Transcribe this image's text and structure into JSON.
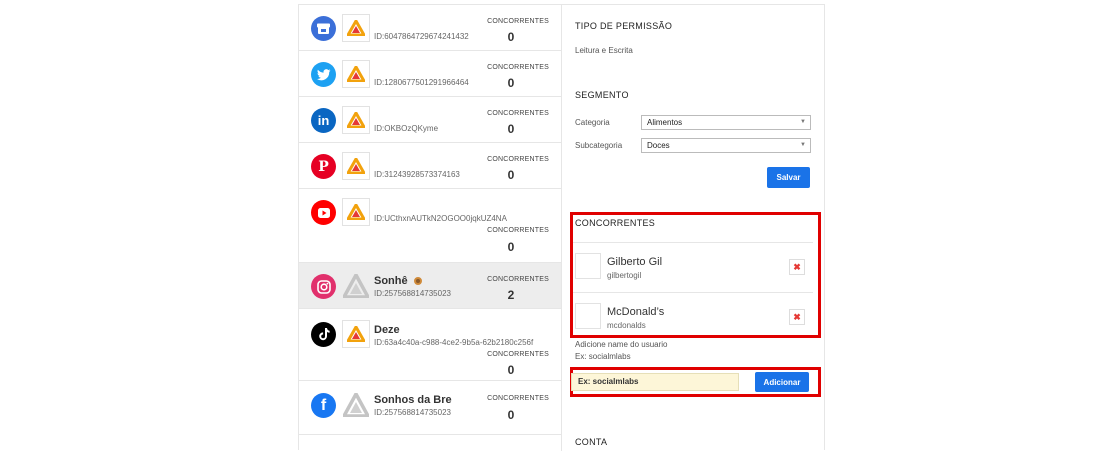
{
  "accounts": [
    {
      "network": "google-business",
      "color": "#3b6fd8",
      "name": "",
      "id": "ID:6047864729674241432",
      "conc_label": "CONCORRENTES",
      "conc_value": "0"
    },
    {
      "network": "twitter",
      "color": "#1da1f2",
      "name": "",
      "id": "ID:1280677501291966464",
      "conc_label": "CONCORRENTES",
      "conc_value": "0"
    },
    {
      "network": "linkedin",
      "color": "#0a66c2",
      "name": "",
      "id": "ID:OKBOzQKyme",
      "conc_label": "CONCORRENTES",
      "conc_value": "0"
    },
    {
      "network": "pinterest",
      "color": "#e60023",
      "name": "",
      "id": "ID:31243928573374163",
      "conc_label": "CONCORRENTES",
      "conc_value": "0"
    },
    {
      "network": "youtube",
      "color": "#ff0000",
      "name": "",
      "id": "ID:UCthxnAUTkN2OGOO0jqkUZ4NA",
      "conc_label": "CONCORRENTES",
      "conc_value": "0"
    },
    {
      "network": "instagram",
      "color": "#e1306c",
      "name": "Sonhê",
      "id": "ID:257568814735023",
      "conc_label": "CONCORRENTES",
      "conc_value": "2"
    },
    {
      "network": "tiktok",
      "color": "#000000",
      "name": "Deze",
      "id": "ID:63a4c40a-c988-4ce2-9b5a-62b2180c256f",
      "conc_label": "CONCORRENTES",
      "conc_value": "0"
    },
    {
      "network": "facebook",
      "color": "#1877f2",
      "name": "Sonhos da Bre",
      "id": "ID:257568814735023",
      "conc_label": "CONCORRENTES",
      "conc_value": "0"
    }
  ],
  "panel": {
    "permission_title": "TIPO DE PERMISSÃO",
    "permission_value": "Leitura e Escrita",
    "segment_title": "SEGMENTO",
    "category_label": "Categoria",
    "category_value": "Alimentos",
    "subcategory_label": "Subcategoria",
    "subcategory_value": "Doces",
    "save_label": "Salvar",
    "competitors_title": "CONCORRENTES",
    "competitors": [
      {
        "name": "Gilberto Gil",
        "username": "gilbertogil"
      },
      {
        "name": "McDonald’s",
        "username": "mcdonalds"
      }
    ],
    "add_hint": "Adicione name do usuario",
    "add_example": "Ex: socialmlabs",
    "add_input_value": "Ex: socialmlabs",
    "add_button": "Adicionar",
    "account_title": "CONTA"
  },
  "colors": {
    "accent": "#1a73e8",
    "highlight": "#e00000",
    "delete": "#e53935"
  }
}
